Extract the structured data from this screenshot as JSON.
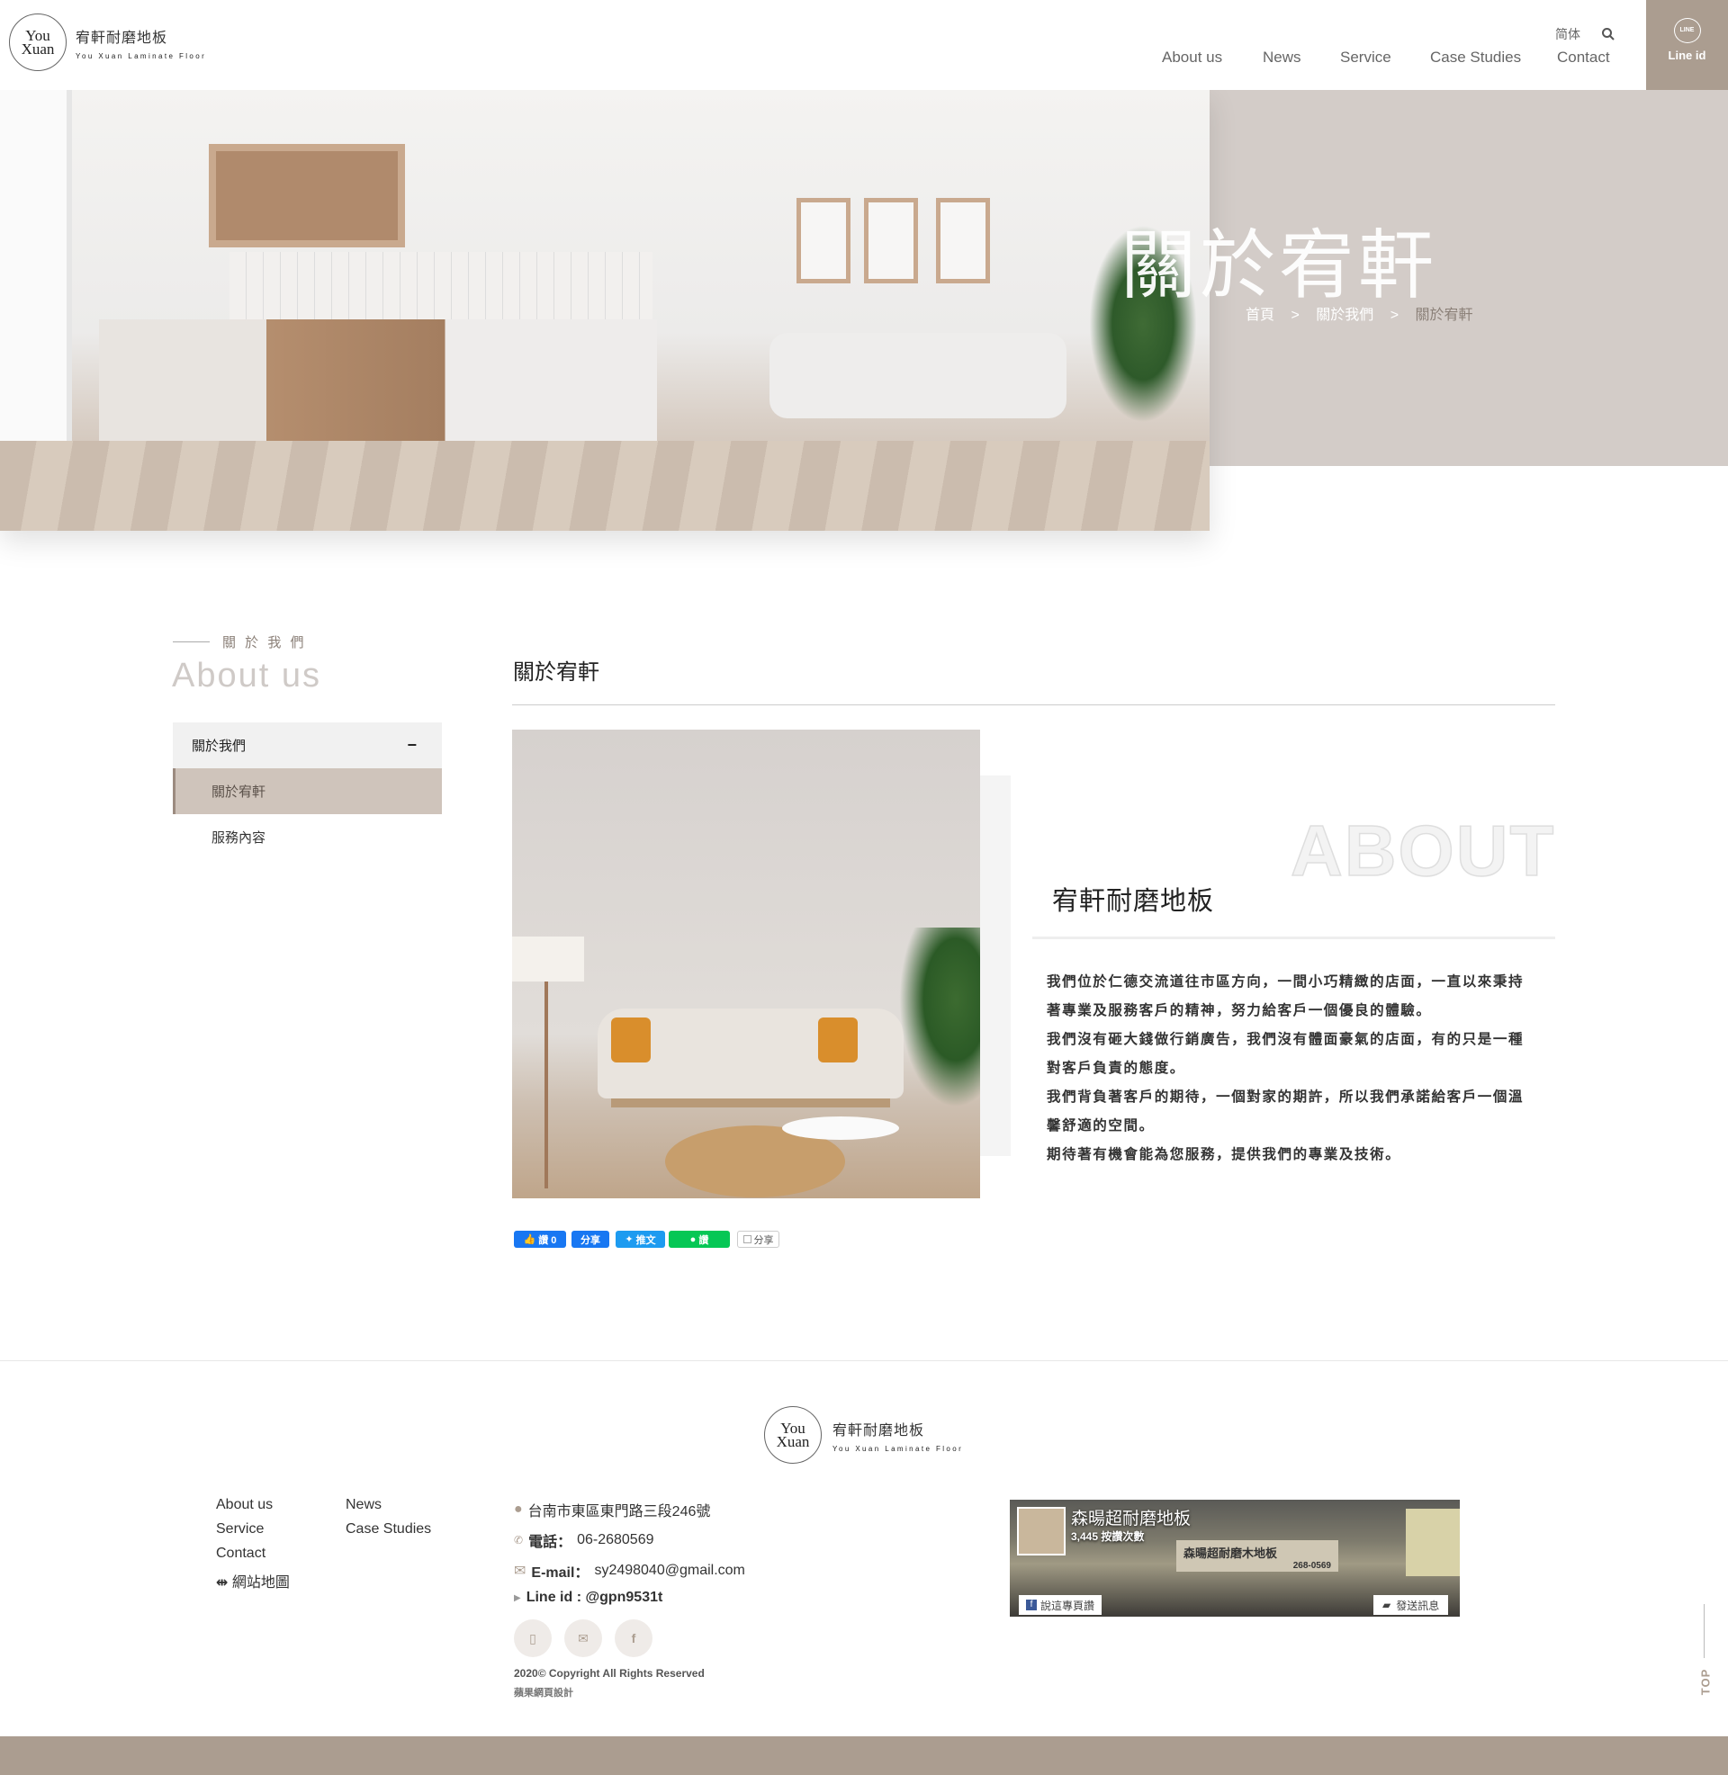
{
  "header": {
    "logo": {
      "mark_line1": "You",
      "mark_line2": "Xuan",
      "name_cn": "宥軒耐磨地板",
      "name_en": "You Xuan Laminate Floor"
    },
    "language_toggle": "简体",
    "search_icon": "search-icon",
    "nav": [
      "About us",
      "News",
      "Service",
      "Case Studies",
      "Contact"
    ],
    "line_button": {
      "badge": "LINE",
      "label": "Line id"
    }
  },
  "hero": {
    "title": "關於宥軒",
    "breadcrumb": [
      "首頁",
      ">",
      "關於我們",
      ">",
      "關於宥軒"
    ]
  },
  "sidebar": {
    "eyebrow": "關 於 我 們",
    "heading": "About us",
    "menu": {
      "parent": "關於我們",
      "toggle": "−",
      "items": [
        {
          "label": "關於宥軒",
          "active": true
        },
        {
          "label": "服務內容",
          "active": false
        }
      ]
    }
  },
  "main": {
    "title": "關於宥軒",
    "watermark": "ABOUT",
    "subtitle": "宥軒耐磨地板",
    "paragraphs": [
      "我們位於仁德交流道往市區方向，一間小巧精緻的店面，一直以來秉持著專業及服務客戶的精神，努力給客戶一個優良的體驗。",
      "我們沒有砸大錢做行銷廣告，我們沒有體面豪氣的店面，有的只是一種對客戶負責的態度。",
      "我們背負著客戶的期待，一個對家的期許，所以我們承諾給客戶一個溫馨舒適的空間。",
      "期待著有機會能為您服務，提供我們的專業及技術。"
    ],
    "share": {
      "like": "讚 0",
      "fb_share": "分享",
      "tweet": "推文",
      "line": "讚",
      "plurk_share": "分享"
    }
  },
  "footer": {
    "logo": {
      "mark_line1": "You",
      "mark_line2": "Xuan",
      "name_cn": "宥軒耐磨地板",
      "name_en": "You Xuan Laminate Floor"
    },
    "links_col1": [
      "About us",
      "Service",
      "Contact"
    ],
    "sitemap": "網站地圖",
    "links_col2": [
      "News",
      "Case Studies"
    ],
    "address": "台南市東區東門路三段246號",
    "phone_label": "電話：",
    "phone": "06-2680569",
    "email_label": "E-mail：",
    "email": "sy2498040@gmail.com",
    "line_id": "Line id : @gpn9531t",
    "copyright": "2020© Copyright All Rights Reserved",
    "designer": "蘋果網頁設計",
    "fb_widget": {
      "page_name": "森暘超耐磨地板",
      "likes": "3,445 按讚次數",
      "like_page": "說這專頁讚",
      "send_message": "發送訊息",
      "sign_text": "森暘超耐磨木地板",
      "sign_phone": "268-0569"
    },
    "top_label": "TOP"
  },
  "colors": {
    "accent": "#ab9d90",
    "hero_panel": "#d3ccc8",
    "menu_active": "#cfc4bb",
    "menu_bg": "#f1f1f1"
  }
}
